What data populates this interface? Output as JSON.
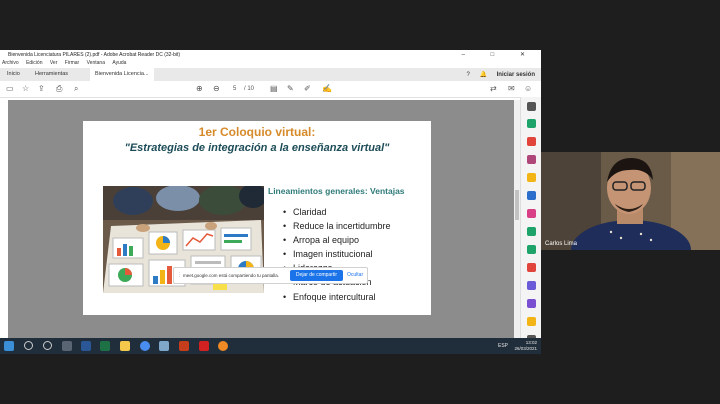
{
  "window": {
    "title": "Bienvenida Licenciatura PILARES (2).pdf - Adobe Acrobat Reader DC (32-bit)",
    "controls": "–  □  ✕"
  },
  "menu": [
    "Archivo",
    "Edición",
    "Ver",
    "Firmar",
    "Ventana",
    "Ayuda"
  ],
  "tabs": [
    "Inicio",
    "Herramientas",
    "Bienvenida Licencia..."
  ],
  "signin": "Iniciar sesión",
  "pager": {
    "current": "5",
    "total": "/ 10"
  },
  "slide": {
    "title1": "1er Coloquio virtual:",
    "title2": "\"Estrategias de integración a la enseñanza virtual\"",
    "subhead": "Lineamientos generales: Ventajas",
    "items": [
      "Claridad",
      "Reduce la incertidumbre",
      "Arropa al equipo",
      "Imagen institucional",
      "Liderazgo",
      "Marco de actuación",
      "Enfoque intercultural"
    ]
  },
  "share": {
    "message": "meet.google.com está compartiendo tu pantalla.",
    "stop": "Dejar de compartir",
    "hide": "Ocultar"
  },
  "taskbar": {
    "lang": "ESP",
    "time": "13:02",
    "date": "26/03/2021"
  },
  "participant": {
    "name": "Carlos Lima"
  },
  "colors": {
    "title_accent": "#d68a2a",
    "title_dark": "#1c4c57",
    "subhead": "#2f7a7a",
    "share_button": "#1a73e8"
  }
}
